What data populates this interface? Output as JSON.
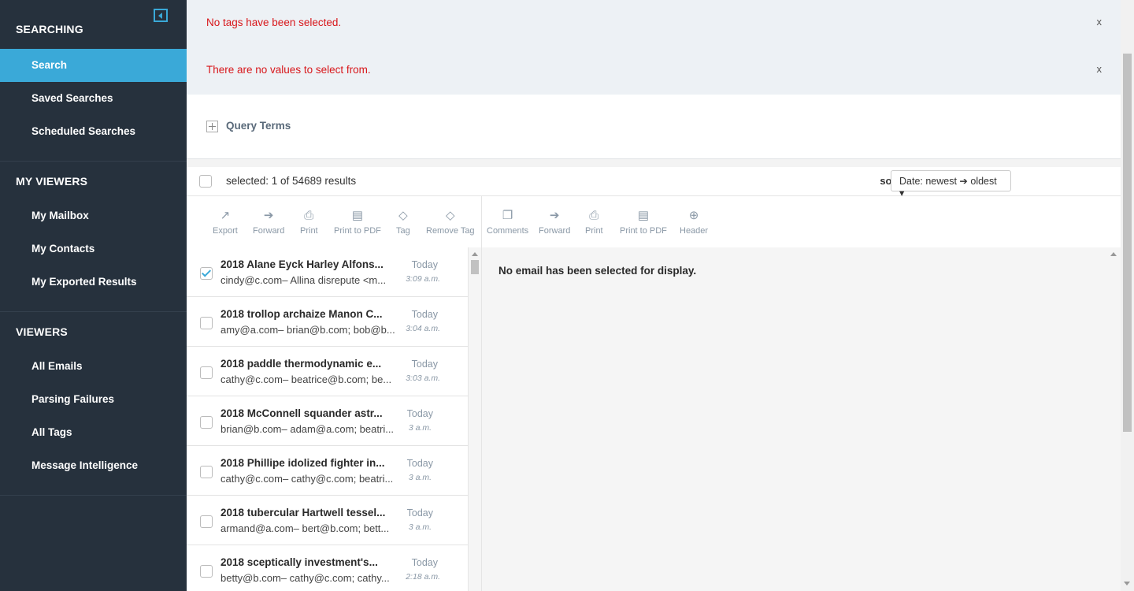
{
  "sidebar": {
    "sections": [
      {
        "heading": "SEARCHING",
        "items": [
          "Search",
          "Saved Searches",
          "Scheduled Searches"
        ]
      },
      {
        "heading": "MY VIEWERS",
        "items": [
          "My Mailbox",
          "My Contacts",
          "My Exported Results"
        ]
      },
      {
        "heading": "VIEWERS",
        "items": [
          "All Emails",
          "Parsing Failures",
          "All Tags",
          "Message Intelligence"
        ]
      }
    ]
  },
  "alerts": {
    "first": "No tags have been selected.",
    "second": "There are no values to select from.",
    "close": "x"
  },
  "query": {
    "label": "Query Terms"
  },
  "results": {
    "count_text": "selected: 1 of 54689 results",
    "sort_label": "sort by:",
    "sort_value": "Date: newest ➔ oldest ▾"
  },
  "toolbar_left": [
    "Export",
    "Forward",
    "Print",
    "Print to PDF",
    "Tag",
    "Remove Tag"
  ],
  "toolbar_right": [
    "Comments",
    "Forward",
    "Print",
    "Print to PDF",
    "Header"
  ],
  "emails": [
    {
      "title": "2018 Alane Eyck Harley Alfons...",
      "sub": "cindy@c.com– Allina disrepute <m...",
      "day": "Today",
      "time": "3:09 a.m."
    },
    {
      "title": "2018 trollop archaize Manon C...",
      "sub": "amy@a.com– brian@b.com; bob@b...",
      "day": "Today",
      "time": "3:04 a.m."
    },
    {
      "title": "2018 paddle thermodynamic e...",
      "sub": "cathy@c.com– beatrice@b.com; be...",
      "day": "Today",
      "time": "3:03 a.m."
    },
    {
      "title": "2018 McConnell squander astr...",
      "sub": "brian@b.com– adam@a.com; beatri...",
      "day": "Today",
      "time": "3 a.m."
    },
    {
      "title": "2018 Phillipe idolized fighter in...",
      "sub": "cathy@c.com– cathy@c.com; beatri...",
      "day": "Today",
      "time": "3 a.m."
    },
    {
      "title": "2018 tubercular Hartwell tessel...",
      "sub": "armand@a.com– bert@b.com; bett...",
      "day": "Today",
      "time": "3 a.m."
    },
    {
      "title": "2018 sceptically investment's...",
      "sub": "betty@b.com– cathy@c.com; cathy...",
      "day": "Today",
      "time": "2:18 a.m."
    }
  ],
  "preview": {
    "empty_text": "No email has been selected for display."
  }
}
